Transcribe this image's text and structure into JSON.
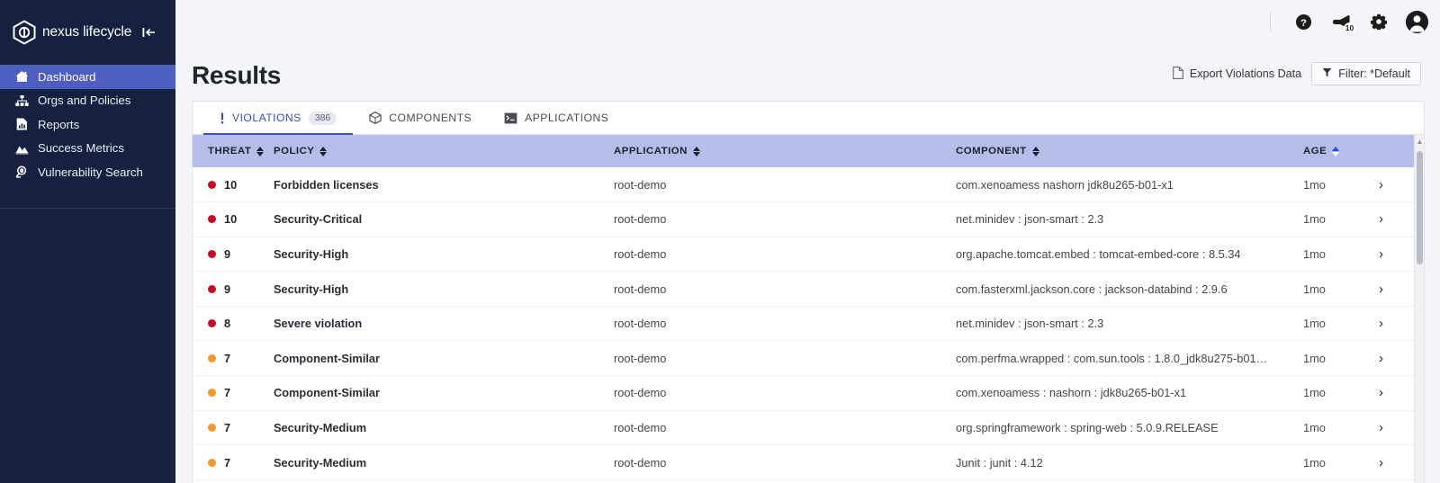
{
  "sidebar": {
    "brand": "nexus lifecycle",
    "collapse_label": "|←",
    "items": [
      {
        "label": "Dashboard",
        "icon": "home-icon",
        "active": true
      },
      {
        "label": "Orgs and Policies",
        "icon": "org-tree-icon",
        "active": false
      },
      {
        "label": "Reports",
        "icon": "report-document-icon",
        "active": false
      },
      {
        "label": "Success Metrics",
        "icon": "chart-mountain-icon",
        "active": false
      },
      {
        "label": "Vulnerability Search",
        "icon": "magnifier-bug-icon",
        "active": false
      }
    ]
  },
  "topbar": {
    "help_icon": "help-circle-icon",
    "notifications_icon": "announcement-icon",
    "notifications_count": "10",
    "settings_icon": "gear-icon",
    "avatar_icon": "user-avatar-icon"
  },
  "page": {
    "title": "Results",
    "export_label": "Export Violations Data",
    "export_icon": "document-icon",
    "filter_label": "Filter: *Default",
    "filter_icon": "funnel-icon"
  },
  "tabs": [
    {
      "label": "VIOLATIONS",
      "count": "386",
      "icon": "exclamation-icon",
      "active": true
    },
    {
      "label": "COMPONENTS",
      "count": "",
      "icon": "cube-icon",
      "active": false
    },
    {
      "label": "APPLICATIONS",
      "count": "",
      "icon": "terminal-icon",
      "active": false
    }
  ],
  "table": {
    "columns": [
      {
        "key": "threat",
        "label": "THREAT",
        "sorted": false
      },
      {
        "key": "policy",
        "label": "POLICY",
        "sorted": false
      },
      {
        "key": "application",
        "label": "APPLICATION",
        "sorted": false
      },
      {
        "key": "component",
        "label": "COMPONENT",
        "sorted": false
      },
      {
        "key": "age",
        "label": "AGE",
        "sorted": true,
        "direction": "asc"
      }
    ],
    "colors": {
      "critical": "#cc0a21",
      "severe": "#f79621"
    },
    "rows": [
      {
        "threat": "10",
        "severity": "critical",
        "policy": "Forbidden licenses",
        "application": "root-demo",
        "component": "com.xenoamess nashorn jdk8u265-b01-x1",
        "age": "1mo"
      },
      {
        "threat": "10",
        "severity": "critical",
        "policy": "Security-Critical",
        "application": "root-demo",
        "component": "net.minidev : json-smart : 2.3",
        "age": "1mo"
      },
      {
        "threat": "9",
        "severity": "critical",
        "policy": "Security-High",
        "application": "root-demo",
        "component": "org.apache.tomcat.embed : tomcat-embed-core : 8.5.34",
        "age": "1mo"
      },
      {
        "threat": "9",
        "severity": "critical",
        "policy": "Security-High",
        "application": "root-demo",
        "component": "com.fasterxml.jackson.core : jackson-databind : 2.9.6",
        "age": "1mo"
      },
      {
        "threat": "8",
        "severity": "critical",
        "policy": "Severe violation",
        "application": "root-demo",
        "component": "net.minidev : json-smart : 2.3",
        "age": "1mo"
      },
      {
        "threat": "7",
        "severity": "severe",
        "policy": "Component-Similar",
        "application": "root-demo",
        "component": "com.perfma.wrapped : com.sun.tools : 1.8.0_jdk8u275-b01…",
        "age": "1mo"
      },
      {
        "threat": "7",
        "severity": "severe",
        "policy": "Component-Similar",
        "application": "root-demo",
        "component": "com.xenoamess : nashorn : jdk8u265-b01-x1",
        "age": "1mo"
      },
      {
        "threat": "7",
        "severity": "severe",
        "policy": "Security-Medium",
        "application": "root-demo",
        "component": "org.springframework : spring-web : 5.0.9.RELEASE",
        "age": "1mo"
      },
      {
        "threat": "7",
        "severity": "severe",
        "policy": "Security-Medium",
        "application": "root-demo",
        "component": "Junit : junit : 4.12",
        "age": "1mo"
      }
    ],
    "row_chevron": "›"
  }
}
